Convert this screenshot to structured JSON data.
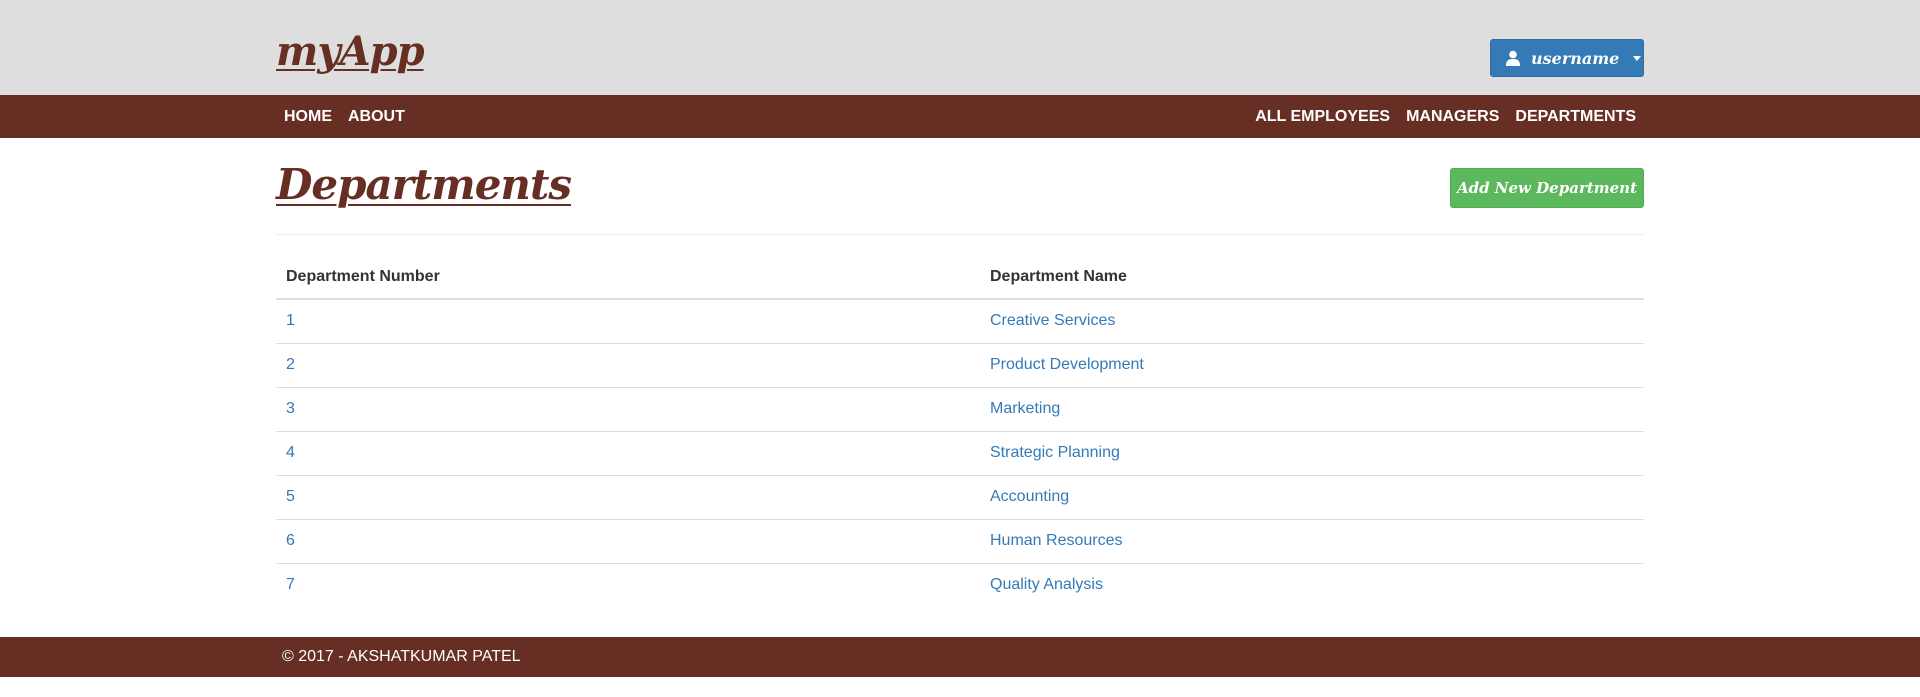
{
  "app": {
    "brand": "myApp",
    "user_label": "username"
  },
  "navbar": {
    "left": [
      "HOME",
      "ABOUT"
    ],
    "right": [
      "ALL EMPLOYEES",
      "MANAGERS",
      "DEPARTMENTS"
    ]
  },
  "page": {
    "title": "Departments",
    "add_button": "Add New Department"
  },
  "table": {
    "headers": [
      "Department Number",
      "Department Name"
    ],
    "rows": [
      [
        "1",
        "Creative Services"
      ],
      [
        "2",
        "Product Development"
      ],
      [
        "3",
        "Marketing"
      ],
      [
        "4",
        "Strategic Planning"
      ],
      [
        "5",
        "Accounting"
      ],
      [
        "6",
        "Human Resources"
      ],
      [
        "7",
        "Quality Analysis"
      ]
    ]
  },
  "footer": {
    "text": "© 2017 - AKSHATKUMAR PATEL"
  },
  "colors": {
    "brand": "#672f24",
    "header_bg": "#dedede",
    "primary": "#337ab7",
    "success": "#5cb85c"
  }
}
